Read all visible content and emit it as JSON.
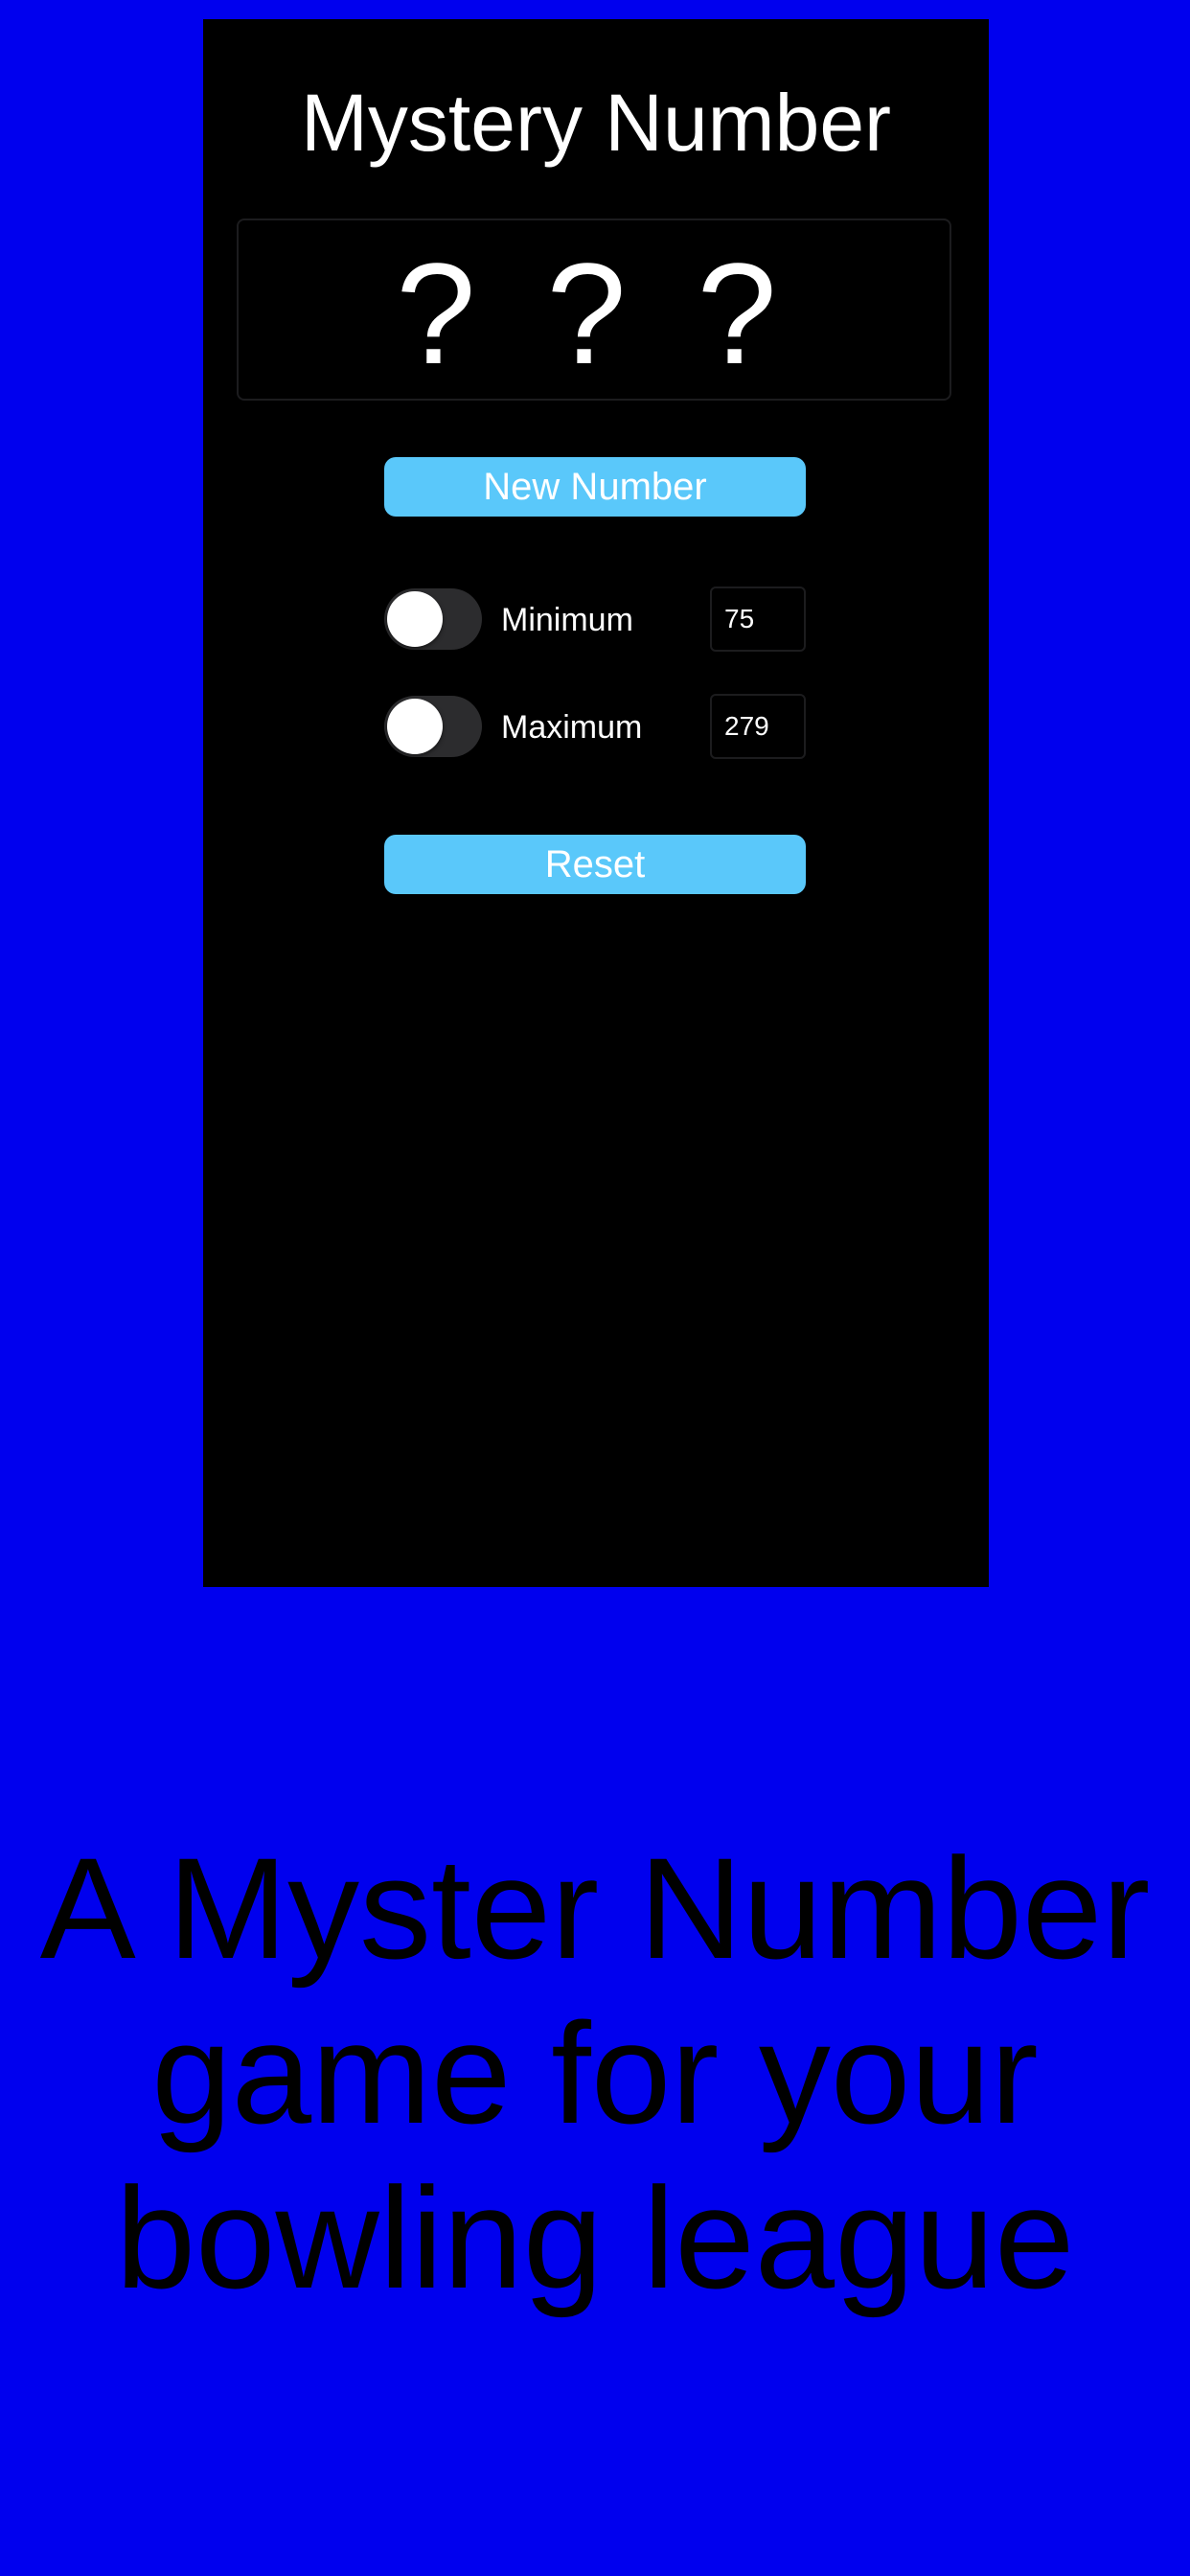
{
  "colors": {
    "background": "#0000ee",
    "app_background": "#000000",
    "button": "#5ac8fa",
    "text_light": "#ffffff",
    "text_dark": "#000000"
  },
  "app": {
    "title": "Mystery Number",
    "mystery_digits": "? ? ?",
    "new_number_label": "New Number",
    "settings": [
      {
        "label": "Minimum",
        "value": "75",
        "toggle_on": false
      },
      {
        "label": "Maximum",
        "value": "279",
        "toggle_on": false
      }
    ],
    "reset_label": "Reset"
  },
  "tagline": "A Myster Number game for your bowling league"
}
